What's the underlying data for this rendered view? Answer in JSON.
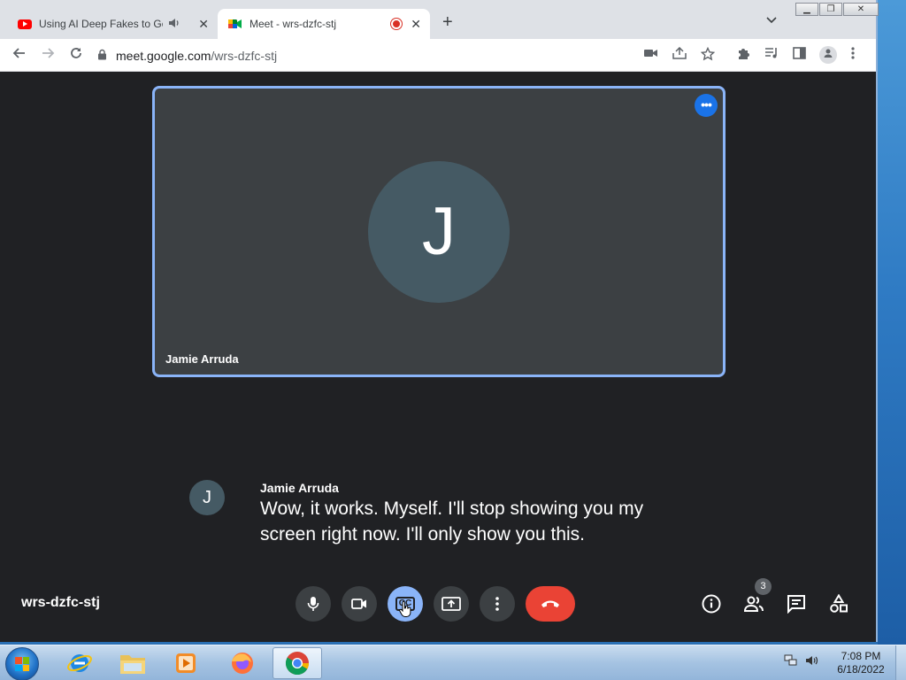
{
  "browser": {
    "tabs": [
      {
        "title": "Using AI Deep Fakes to Get F",
        "icon": "youtube-icon",
        "audio": "speaker-icon"
      },
      {
        "title": "Meet - wrs-dzfc-stj",
        "icon": "google-meet-icon",
        "recording": "recording-icon"
      }
    ],
    "url_domain": "meet.google.com",
    "url_path": "/wrs-dzfc-stj"
  },
  "meet": {
    "tile": {
      "avatar_initial": "J",
      "participant_name": "Jamie Arruda"
    },
    "caption": {
      "avatar_initial": "J",
      "speaker": "Jamie Arruda",
      "text": "Wow, it works. Myself. I'll stop showing you my screen right now. I'll only show you this."
    },
    "meeting_code": "wrs-dzfc-stj",
    "participants_count": "3",
    "controls": [
      "microphone",
      "camera",
      "captions",
      "present-screen",
      "more-options",
      "leave-call"
    ],
    "side_controls": [
      "meeting-details",
      "people",
      "chat",
      "activities"
    ],
    "colors": {
      "background": "#202124",
      "tile": "#3c4043",
      "tile_border": "#8ab4f8",
      "avatar": "#455a64",
      "end_call": "#ea4335",
      "captions_active": "#8ab4f8"
    }
  },
  "taskbar": {
    "time": "7:08 PM",
    "date": "6/18/2022",
    "apps": [
      "internet-explorer",
      "file-explorer",
      "media-player",
      "firefox",
      "chrome"
    ]
  }
}
